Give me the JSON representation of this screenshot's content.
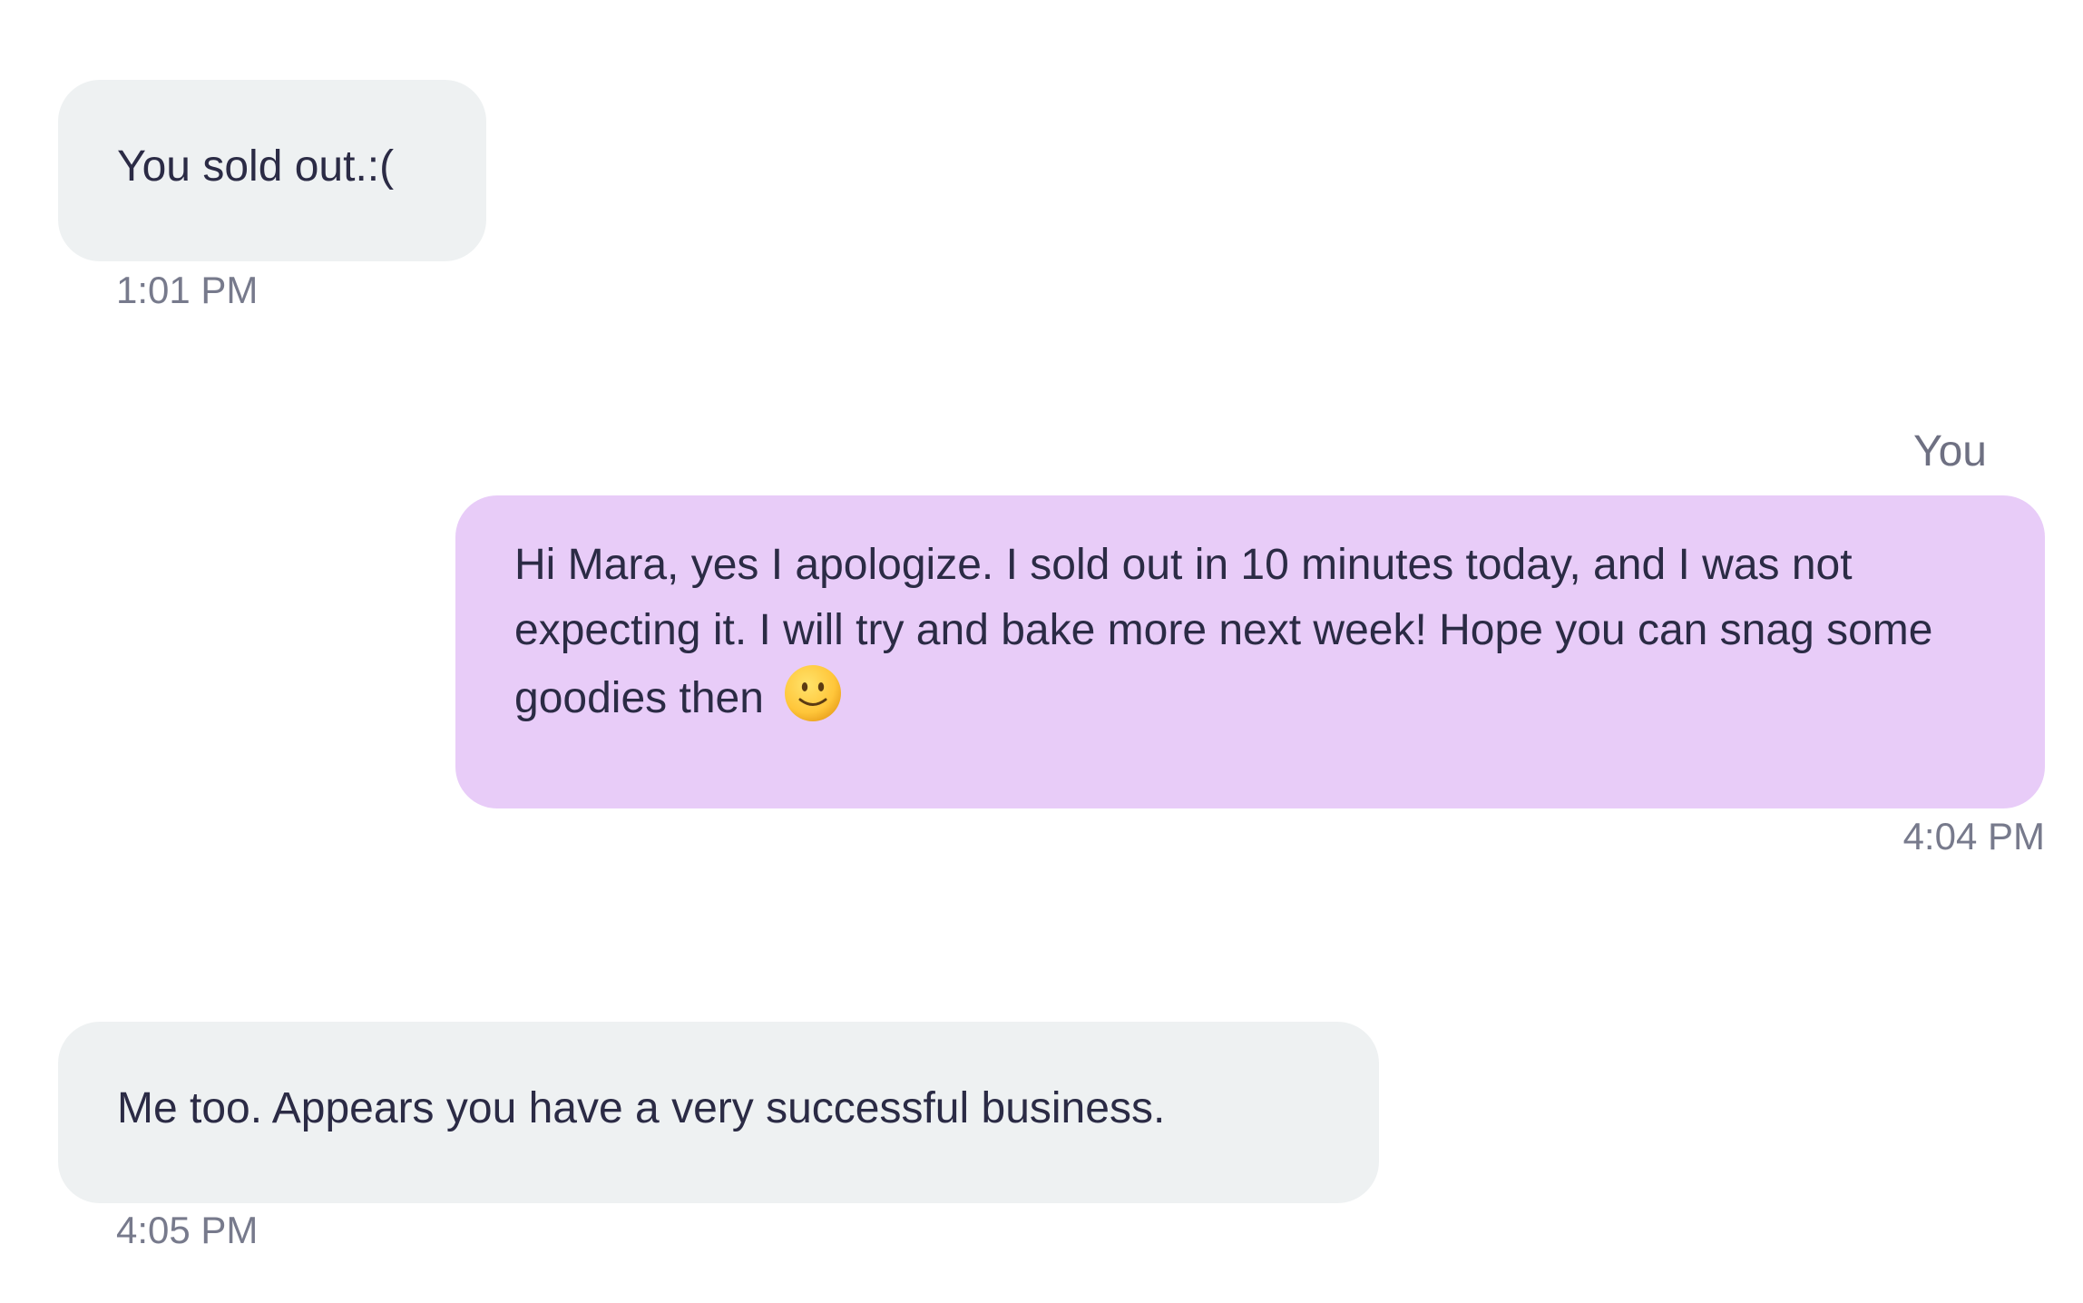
{
  "conversation": {
    "messages": [
      {
        "direction": "incoming",
        "text": "You sold out.:(",
        "time": "1:01 PM"
      },
      {
        "direction": "outgoing",
        "sender": "You",
        "text": "Hi Mara, yes I apologize. I sold out in 10 minutes today, and I was not expecting it. I will try and bake more next week! Hope you can snag some goodies then",
        "emoji": "slightly-smiling-face-icon",
        "time": "4:04 PM"
      },
      {
        "direction": "incoming",
        "text": "Me too. Appears you have a very successful business.",
        "time": "4:05 PM"
      }
    ]
  },
  "colors": {
    "incoming_bubble": "#eef1f2",
    "outgoing_bubble": "#e8ccf8",
    "text": "#2b2b45",
    "timestamp": "#777a8c"
  }
}
